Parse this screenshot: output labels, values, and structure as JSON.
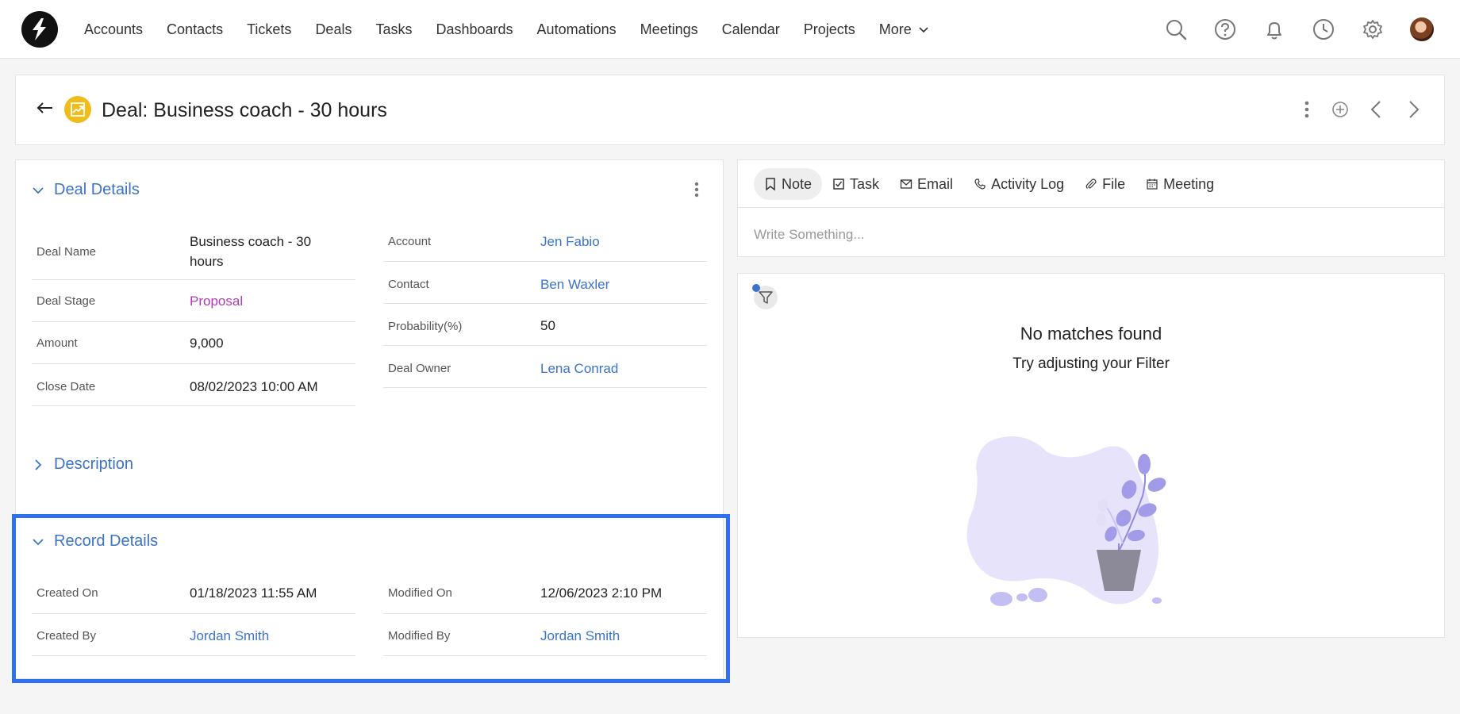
{
  "nav": {
    "items": [
      "Accounts",
      "Contacts",
      "Tickets",
      "Deals",
      "Tasks",
      "Dashboards",
      "Automations",
      "Meetings",
      "Calendar",
      "Projects"
    ],
    "more_label": "More"
  },
  "header": {
    "title": "Deal: Business coach - 30 hours"
  },
  "deal_details": {
    "title": "Deal Details",
    "left_fields": [
      {
        "label": "Deal Name",
        "value": "Business coach - 30 hours"
      },
      {
        "label": "Deal Stage",
        "value": "Proposal"
      },
      {
        "label": "Amount",
        "value": "9,000"
      },
      {
        "label": "Close Date",
        "value": "08/02/2023 10:00 AM"
      }
    ],
    "right_fields": [
      {
        "label": "Account",
        "value": "Jen Fabio"
      },
      {
        "label": "Contact",
        "value": "Ben Waxler"
      },
      {
        "label": "Probability(%)",
        "value": "50"
      },
      {
        "label": "Deal Owner",
        "value": "Lena Conrad"
      }
    ]
  },
  "description": {
    "title": "Description"
  },
  "record_details": {
    "title": "Record Details",
    "left_fields": [
      {
        "label": "Created On",
        "value": "01/18/2023 11:55 AM"
      },
      {
        "label": "Created By",
        "value": "Jordan Smith"
      }
    ],
    "right_fields": [
      {
        "label": "Modified On",
        "value": "12/06/2023 2:10 PM"
      },
      {
        "label": "Modified By",
        "value": "Jordan Smith"
      }
    ]
  },
  "composer": {
    "tabs": [
      "Note",
      "Task",
      "Email",
      "Activity Log",
      "File",
      "Meeting"
    ],
    "placeholder": "Write Something..."
  },
  "activity": {
    "empty_title": "No matches found",
    "empty_subtitle": "Try adjusting your Filter"
  },
  "colors": {
    "link": "#3b73c9",
    "stage": "#b23ab8",
    "highlight": "#2f6ff2",
    "deal_badge": "#f0bc1a"
  }
}
